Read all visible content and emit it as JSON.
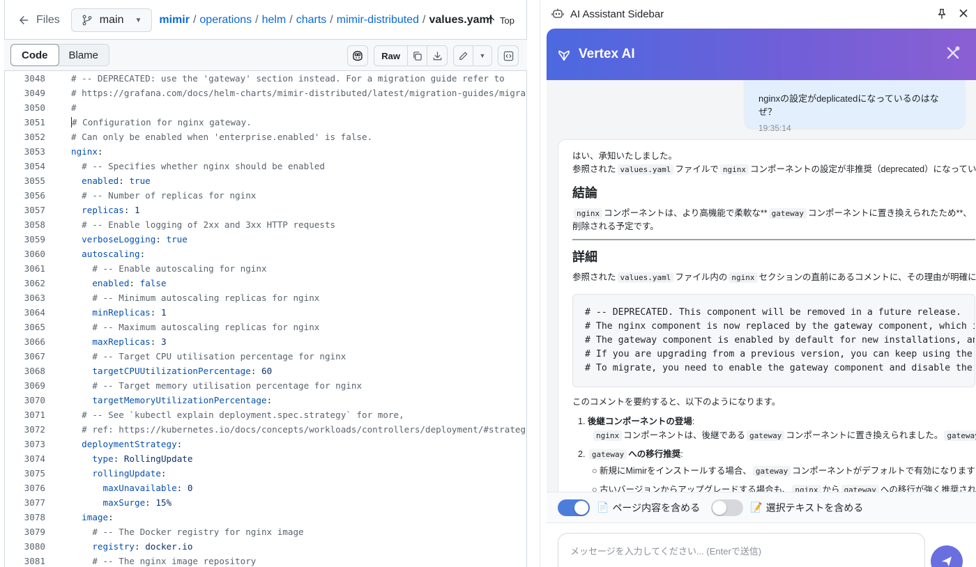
{
  "nav": {
    "files_label": "Files",
    "branch": "main",
    "repo": "mimir",
    "path": [
      "operations",
      "helm",
      "charts",
      "mimir-distributed"
    ],
    "file": "values.yaml",
    "top_label": "Top"
  },
  "toolbar": {
    "code_label": "Code",
    "blame_label": "Blame",
    "raw_label": "Raw"
  },
  "code_lines": [
    {
      "n": "3048",
      "t": "# -- DEPRECATED: use the 'gateway' section instead. For a migration guide refer to",
      "k": "com",
      "i": 0
    },
    {
      "n": "3049",
      "t": "# https://grafana.com/docs/helm-charts/mimir-distributed/latest/migration-guides/migra",
      "k": "com",
      "i": 0
    },
    {
      "n": "3050",
      "t": "#",
      "k": "com",
      "i": 0
    },
    {
      "n": "3051",
      "t": "# Configuration for nginx gateway.",
      "k": "com",
      "i": 0
    },
    {
      "n": "3052",
      "t": "# Can only be enabled when 'enterprise.enabled' is false.",
      "k": "com",
      "i": 0
    },
    {
      "n": "3053",
      "key": "nginx",
      "v": "",
      "i": 0
    },
    {
      "n": "3054",
      "t": "# -- Specifies whether nginx should be enabled",
      "k": "com",
      "i": 1
    },
    {
      "n": "3055",
      "key": "enabled",
      "v": "true",
      "i": 1
    },
    {
      "n": "3056",
      "t": "# -- Number of replicas for nginx",
      "k": "com",
      "i": 1
    },
    {
      "n": "3057",
      "key": "replicas",
      "v": "1",
      "i": 1
    },
    {
      "n": "3058",
      "t": "# -- Enable logging of 2xx and 3xx HTTP requests",
      "k": "com",
      "i": 1
    },
    {
      "n": "3059",
      "key": "verboseLogging",
      "v": "true",
      "i": 1
    },
    {
      "n": "3060",
      "key": "autoscaling",
      "v": "",
      "i": 1
    },
    {
      "n": "3061",
      "t": "# -- Enable autoscaling for nginx",
      "k": "com",
      "i": 2
    },
    {
      "n": "3062",
      "key": "enabled",
      "v": "false",
      "i": 2
    },
    {
      "n": "3063",
      "t": "# -- Minimum autoscaling replicas for nginx",
      "k": "com",
      "i": 2
    },
    {
      "n": "3064",
      "key": "minReplicas",
      "v": "1",
      "i": 2
    },
    {
      "n": "3065",
      "t": "# -- Maximum autoscaling replicas for nginx",
      "k": "com",
      "i": 2
    },
    {
      "n": "3066",
      "key": "maxReplicas",
      "v": "3",
      "i": 2
    },
    {
      "n": "3067",
      "t": "# -- Target CPU utilisation percentage for nginx",
      "k": "com",
      "i": 2
    },
    {
      "n": "3068",
      "key": "targetCPUUtilizationPercentage",
      "v": "60",
      "i": 2
    },
    {
      "n": "3069",
      "t": "# -- Target memory utilisation percentage for nginx",
      "k": "com",
      "i": 2
    },
    {
      "n": "3070",
      "key": "targetMemoryUtilizationPercentage",
      "v": "",
      "i": 2
    },
    {
      "n": "3071",
      "t": "# -- See `kubectl explain deployment.spec.strategy` for more,",
      "k": "com",
      "i": 1
    },
    {
      "n": "3072",
      "t": "# ref: https://kubernetes.io/docs/concepts/workloads/controllers/deployment/#strateg",
      "k": "com",
      "i": 1
    },
    {
      "n": "3073",
      "key": "deploymentStrategy",
      "v": "",
      "i": 1
    },
    {
      "n": "3074",
      "key": "type",
      "v": "RollingUpdate",
      "i": 2
    },
    {
      "n": "3075",
      "key": "rollingUpdate",
      "v": "",
      "i": 2
    },
    {
      "n": "3076",
      "key": "maxUnavailable",
      "v": "0",
      "i": 3
    },
    {
      "n": "3077",
      "key": "maxSurge",
      "v": "15%",
      "i": 3
    },
    {
      "n": "3078",
      "key": "image",
      "v": "",
      "i": 1
    },
    {
      "n": "3079",
      "t": "# -- The Docker registry for nginx image",
      "k": "com",
      "i": 2
    },
    {
      "n": "3080",
      "key": "registry",
      "v": "docker.io",
      "i": 2
    },
    {
      "n": "3081",
      "t": "# -- The nginx image repository",
      "k": "com",
      "i": 2
    }
  ],
  "sidebar": {
    "title": "AI Assistant Sidebar",
    "brand": "Vertex AI",
    "user_message": "nginxの設定がdeplicatedになっているのはなぜ？",
    "user_time": "19:35:14",
    "bot": {
      "intro1": "はい、承知いたしました。",
      "intro2_a": "参照された",
      "intro2_code1": "values.yaml",
      "intro2_b": "ファイルで",
      "intro2_code2": "nginx",
      "intro2_c": "コンポーネントの設定が非推奨（deprecated）になってい",
      "h_conclusion": "結論",
      "concl_code1": "nginx",
      "concl_a": "コンポーネントは、より高機能で柔軟な**",
      "concl_code2": "gateway",
      "concl_b": "コンポーネントに置き換えられたため**、",
      "concl_2": "削除される予定です。",
      "h_detail": "詳細",
      "detail_a": "参照された",
      "detail_code1": "values.yaml",
      "detail_b": "ファイル内の",
      "detail_code2": "nginx",
      "detail_c": "セクションの直前にあるコメントに、その理由が明確に",
      "codeblock": "# -- DEPRECATED. This component will be removed in a future release.\n# The nginx component is now replaced by the gateway component, which i\n# The gateway component is enabled by default for new installations, an\n# If you are upgrading from a previous version, you can keep using the\n# To migrate, you need to enable the gateway component and disable the",
      "summary": "このコメントを要約すると、以下のようになります。",
      "li1_title": "後継コンポーネントの登場",
      "li1_code1": "nginx",
      "li1_a": "コンポーネントは、後継である",
      "li1_code2": "gateway",
      "li1_b": "コンポーネントに置き換えられました。",
      "li1_code3": "gateway",
      "li2_code": "gateway",
      "li2_title": "への移行推奨",
      "sub1_a": "新規にMimirをインストールする場合、",
      "sub1_code": "gateway",
      "sub1_b": "コンポーネントがデフォルトで有効になります",
      "sub2_a": "古いバージョンからアップグレードする場合も、",
      "sub2_code1": "nginx",
      "sub2_b": "から",
      "sub2_code2": "gateway",
      "sub2_c": "への移行が強く推奨され"
    },
    "include_page_label": "ページ内容を含める",
    "include_page_on": true,
    "include_selection_label": "選択テキストを含める",
    "include_selection_on": false,
    "input_placeholder": "メッセージを入力してください... (Enterで送信)"
  },
  "colors": {
    "accent": "#0969da",
    "brand_gradient_start": "#4c69e0",
    "brand_gradient_end": "#8b5fd3",
    "toggle_on": "#4c7ddc"
  }
}
